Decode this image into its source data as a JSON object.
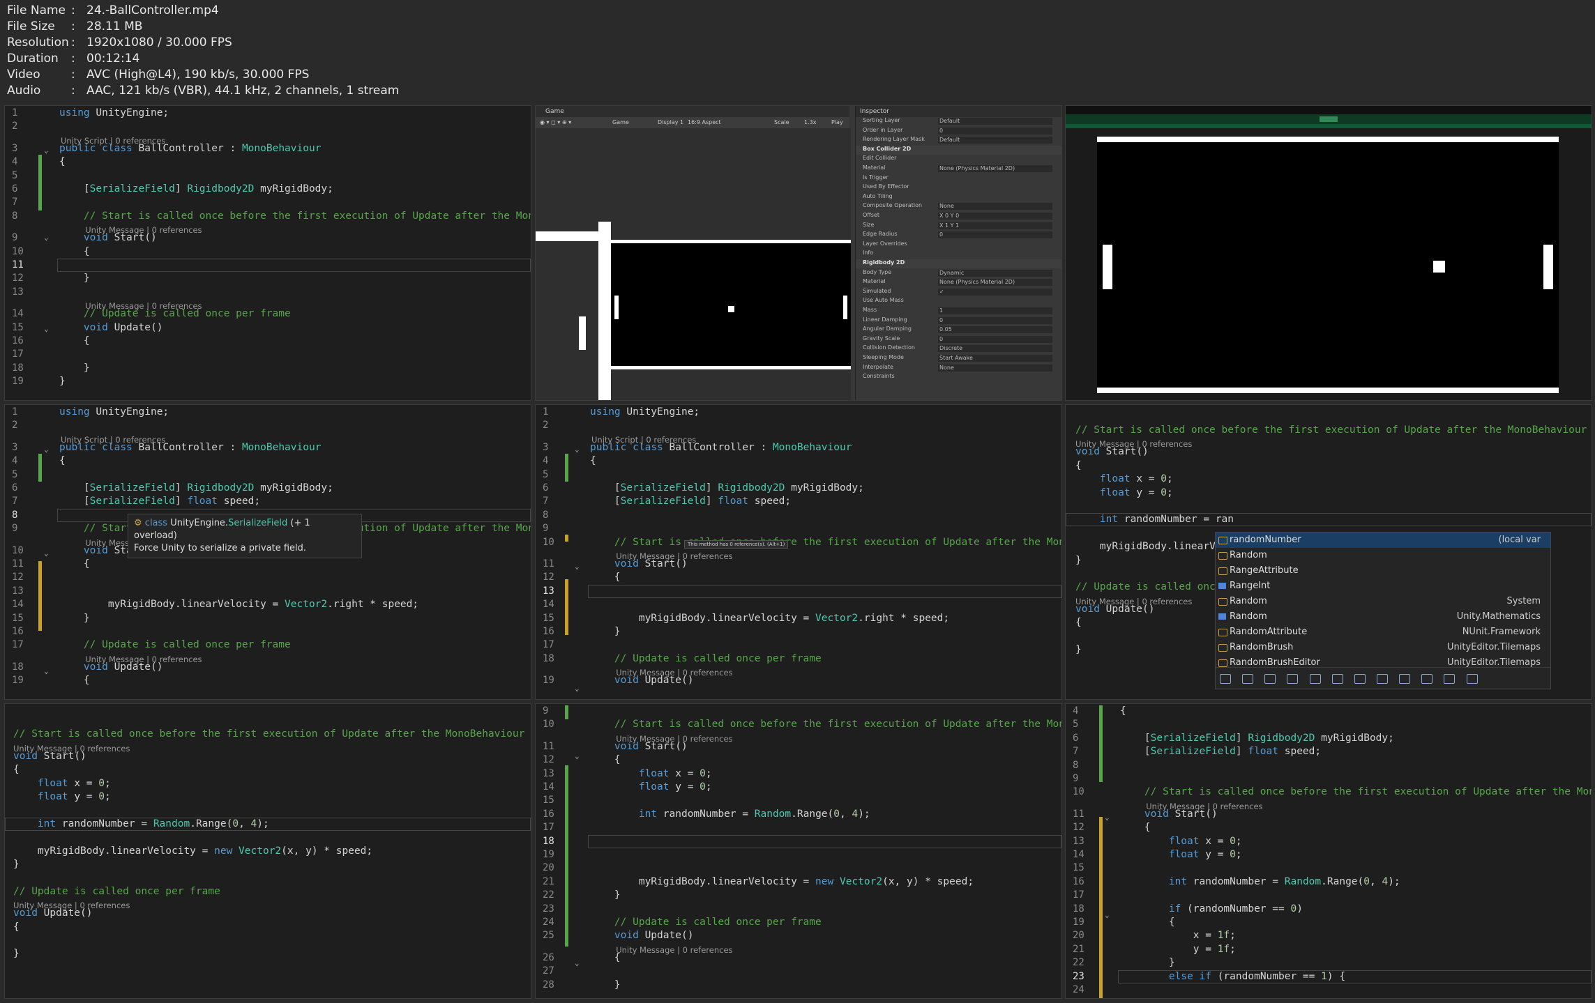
{
  "meta": {
    "rows": [
      {
        "key": "File Name",
        "value": "24.-BallController.mp4"
      },
      {
        "key": "File Size",
        "value": "28.11 MB"
      },
      {
        "key": "Resolution",
        "value": "1920x1080 / 30.000 FPS"
      },
      {
        "key": "Duration",
        "value": "00:12:14"
      },
      {
        "key": "Video",
        "value": "AVC (High@L4), 190 kb/s, 30.000 FPS"
      },
      {
        "key": "Audio",
        "value": "AAC, 121 kb/s (VBR), 44.1 kHz, 2 channels, 1 stream"
      }
    ],
    "sep": ":"
  },
  "lens": {
    "script": "Unity Script | 0 references",
    "message": "Unity Message | 0 references"
  },
  "tile1": {
    "lines": [
      {
        "n": "1",
        "t": "using UnityEngine;"
      },
      {
        "n": "2",
        "t": ""
      },
      {
        "n": "3",
        "t": "public class BallController : MonoBehaviour"
      },
      {
        "n": "4",
        "t": "{"
      },
      {
        "n": "5",
        "t": ""
      },
      {
        "n": "6",
        "t": "    [SerializeField] Rigidbody2D myRigidBody;"
      },
      {
        "n": "7",
        "t": ""
      },
      {
        "n": "8",
        "t": "    // Start is called once before the first execution of Update after the MonoBehaviour"
      },
      {
        "n": "9",
        "t": "    void Start()"
      },
      {
        "n": "10",
        "t": "    {"
      },
      {
        "n": "11",
        "t": "        "
      },
      {
        "n": "12",
        "t": "    }"
      },
      {
        "n": "13",
        "t": ""
      },
      {
        "n": "14",
        "t": "    // Update is called once per frame"
      },
      {
        "n": "15",
        "t": "    void Update()"
      },
      {
        "n": "16",
        "t": "    {"
      },
      {
        "n": "17",
        "t": ""
      },
      {
        "n": "18",
        "t": "    }"
      },
      {
        "n": "19",
        "t": "}"
      }
    ]
  },
  "tile2": {
    "tab": "Game",
    "display": "Display 1",
    "aspect": "16:9 Aspect",
    "scale_label": "Scale",
    "scale_value": "1.3x",
    "play": "Play Fo",
    "inspector_title": "Inspector",
    "rows": [
      {
        "l": "Sorting Layer",
        "v": "Default"
      },
      {
        "l": "Order in Layer",
        "v": "0"
      },
      {
        "l": "Rendering Layer Mask",
        "v": "Default"
      },
      {
        "l": "Box Collider 2D",
        "v": "",
        "h": true
      },
      {
        "l": "Edit Collider",
        "v": ""
      },
      {
        "l": "Material",
        "v": "None (Physics Material 2D)"
      },
      {
        "l": "Is Trigger",
        "v": ""
      },
      {
        "l": "Used By Effector",
        "v": ""
      },
      {
        "l": "Auto Tiling",
        "v": ""
      },
      {
        "l": "Composite Operation",
        "v": "None"
      },
      {
        "l": "Offset",
        "v": "X 0        Y 0"
      },
      {
        "l": "Size",
        "v": "X 1        Y 1"
      },
      {
        "l": "Edge Radius",
        "v": "0"
      },
      {
        "l": "Layer Overrides",
        "v": ""
      },
      {
        "l": "Info",
        "v": ""
      },
      {
        "l": "Rigidbody 2D",
        "v": "",
        "h": true
      },
      {
        "l": "Body Type",
        "v": "Dynamic"
      },
      {
        "l": "Material",
        "v": "None (Physics Material 2D)"
      },
      {
        "l": "Simulated",
        "v": "✓"
      },
      {
        "l": "Use Auto Mass",
        "v": ""
      },
      {
        "l": "Mass",
        "v": "1"
      },
      {
        "l": "Linear Damping",
        "v": "0"
      },
      {
        "l": "Angular Damping",
        "v": "0.05"
      },
      {
        "l": "Gravity Scale",
        "v": "0"
      },
      {
        "l": "Collision Detection",
        "v": "Discrete"
      },
      {
        "l": "Sleeping Mode",
        "v": "Start Awake"
      },
      {
        "l": "Interpolate",
        "v": "None"
      },
      {
        "l": "Constraints",
        "v": ""
      }
    ]
  },
  "tile4": {
    "lines": [
      {
        "n": "1",
        "t": "using UnityEngine;"
      },
      {
        "n": "2",
        "t": ""
      },
      {
        "n": "3",
        "t": "public class BallController : MonoBehaviour"
      },
      {
        "n": "4",
        "t": "{"
      },
      {
        "n": "5",
        "t": ""
      },
      {
        "n": "6",
        "t": "    [SerializeField] Rigidbody2D myRigidBody;"
      },
      {
        "n": "7",
        "t": "    [SerializeField] float speed;"
      },
      {
        "n": "8",
        "t": ""
      },
      {
        "n": "9",
        "t": "    // Start is called once before the first execution of Update after the MonoBehaviour"
      },
      {
        "n": "10",
        "t": "    void Start()"
      },
      {
        "n": "11",
        "t": "    {"
      },
      {
        "n": "12",
        "t": ""
      },
      {
        "n": "13",
        "t": ""
      },
      {
        "n": "14",
        "t": "        myRigidBody.linearVelocity = Vector2.right * speed;"
      },
      {
        "n": "15",
        "t": "    }"
      },
      {
        "n": "16",
        "t": ""
      },
      {
        "n": "17",
        "t": "    // Update is called once per frame"
      },
      {
        "n": "18",
        "t": "    void Update()"
      },
      {
        "n": "19",
        "t": "    {"
      }
    ],
    "tooltip_kind": "class",
    "tooltip_ns": "UnityEngine.",
    "tooltip_name": "SerializeField",
    "tooltip_over": " (+ 1 overload)",
    "tooltip_desc": "Force Unity to serialize a private field."
  },
  "tile5": {
    "lines": [
      {
        "n": "1",
        "t": "using UnityEngine;"
      },
      {
        "n": "2",
        "t": ""
      },
      {
        "n": "3",
        "t": "public class BallController : MonoBehaviour"
      },
      {
        "n": "4",
        "t": "{"
      },
      {
        "n": "5",
        "t": ""
      },
      {
        "n": "6",
        "t": "    [SerializeField] Rigidbody2D myRigidBody;"
      },
      {
        "n": "7",
        "t": "    [SerializeField] float speed;"
      },
      {
        "n": "8",
        "t": ""
      },
      {
        "n": "9",
        "t": ""
      },
      {
        "n": "10",
        "t": "    // Start is called once before the first execution of Update after the MonoBehaviour"
      },
      {
        "n": "11",
        "t": "    void Start()"
      },
      {
        "n": "12",
        "t": "    {"
      },
      {
        "n": "13",
        "t": ""
      },
      {
        "n": "14",
        "t": ""
      },
      {
        "n": "15",
        "t": "        myRigidBody.linearVelocity = Vector2.right * speed;"
      },
      {
        "n": "16",
        "t": "    }"
      },
      {
        "n": "17",
        "t": ""
      },
      {
        "n": "18",
        "t": "    // Update is called once per frame"
      },
      {
        "n": "19",
        "t": "    void Update()"
      }
    ],
    "hint": "This method has 0 reference(s). (Alt+1)"
  },
  "tile6": {
    "lines": [
      {
        "t": "// Start is called once before the first execution of Update after the MonoBehaviour"
      },
      {
        "t": "void Start()"
      },
      {
        "t": "{"
      },
      {
        "t": "    float x = 0;"
      },
      {
        "t": "    float y = 0;"
      },
      {
        "t": ""
      },
      {
        "t": "    int randomNumber = ran"
      },
      {
        "t": ""
      },
      {
        "t": "    myRigidBody.linearV"
      },
      {
        "t": "}"
      },
      {
        "t": ""
      },
      {
        "t": "// Update is called onc"
      },
      {
        "t": "void Update()"
      },
      {
        "t": "{"
      },
      {
        "t": ""
      },
      {
        "t": "}"
      }
    ],
    "completions": [
      {
        "label": "randomNumber",
        "ns": "(local var",
        "icon": "cls"
      },
      {
        "label": "Random",
        "ns": "",
        "icon": "cls"
      },
      {
        "label": "RangeAttribute",
        "ns": "",
        "icon": "cls"
      },
      {
        "label": "RangeInt",
        "ns": "",
        "icon": "st"
      },
      {
        "label": "Random",
        "ns": "System",
        "icon": "cls"
      },
      {
        "label": "Random",
        "ns": "Unity.Mathematics",
        "icon": "st"
      },
      {
        "label": "RandomAttribute",
        "ns": "NUnit.Framework",
        "icon": "cls"
      },
      {
        "label": "RandomBrush",
        "ns": "UnityEditor.Tilemaps",
        "icon": "cls"
      },
      {
        "label": "RandomBrushEditor",
        "ns": "UnityEditor.Tilemaps",
        "icon": "cls"
      }
    ]
  },
  "tile7": {
    "lines": [
      {
        "t": ""
      },
      {
        "t": "// Start is called once before the first execution of Update after the MonoBehaviour"
      },
      {
        "t": "void Start()"
      },
      {
        "t": "{"
      },
      {
        "t": "    float x = 0;"
      },
      {
        "t": "    float y = 0;"
      },
      {
        "t": ""
      },
      {
        "t": "    int randomNumber = Random.Range(0, 4);"
      },
      {
        "t": ""
      },
      {
        "t": "    myRigidBody.linearVelocity = new Vector2(x, y) * speed;"
      },
      {
        "t": "}"
      },
      {
        "t": ""
      },
      {
        "t": "// Update is called once per frame"
      },
      {
        "t": "void Update()"
      },
      {
        "t": "{"
      },
      {
        "t": ""
      },
      {
        "t": "}"
      }
    ]
  },
  "tile8": {
    "lines": [
      {
        "n": "9",
        "t": ""
      },
      {
        "n": "10",
        "t": "    // Start is called once before the first execution of Update after the MonoBehaviour"
      },
      {
        "n": "11",
        "t": "    void Start()"
      },
      {
        "n": "12",
        "t": "    {"
      },
      {
        "n": "13",
        "t": "        float x = 0;"
      },
      {
        "n": "14",
        "t": "        float y = 0;"
      },
      {
        "n": "15",
        "t": ""
      },
      {
        "n": "16",
        "t": "        int randomNumber = Random.Range(0, 4);"
      },
      {
        "n": "17",
        "t": ""
      },
      {
        "n": "18",
        "t": ""
      },
      {
        "n": "19",
        "t": ""
      },
      {
        "n": "20",
        "t": ""
      },
      {
        "n": "21",
        "t": "        myRigidBody.linearVelocity = new Vector2(x, y) * speed;"
      },
      {
        "n": "22",
        "t": "    }"
      },
      {
        "n": "23",
        "t": ""
      },
      {
        "n": "24",
        "t": "    // Update is called once per frame"
      },
      {
        "n": "25",
        "t": "    void Update()"
      },
      {
        "n": "26",
        "t": "    {"
      },
      {
        "n": "27",
        "t": ""
      },
      {
        "n": "28",
        "t": "    }"
      }
    ]
  },
  "tile9": {
    "lines": [
      {
        "n": "4",
        "t": "{"
      },
      {
        "n": "5",
        "t": ""
      },
      {
        "n": "6",
        "t": "    [SerializeField] Rigidbody2D myRigidBody;"
      },
      {
        "n": "7",
        "t": "    [SerializeField] float speed;"
      },
      {
        "n": "8",
        "t": ""
      },
      {
        "n": "9",
        "t": ""
      },
      {
        "n": "10",
        "t": "    // Start is called once before the first execution of Update after the MonoBehaviour"
      },
      {
        "n": "11",
        "t": "    void Start()"
      },
      {
        "n": "12",
        "t": "    {"
      },
      {
        "n": "13",
        "t": "        float x = 0;"
      },
      {
        "n": "14",
        "t": "        float y = 0;"
      },
      {
        "n": "15",
        "t": ""
      },
      {
        "n": "16",
        "t": "        int randomNumber = Random.Range(0, 4);"
      },
      {
        "n": "17",
        "t": ""
      },
      {
        "n": "18",
        "t": "        if (randomNumber == 0)"
      },
      {
        "n": "19",
        "t": "        {"
      },
      {
        "n": "20",
        "t": "            x = 1f;"
      },
      {
        "n": "21",
        "t": "            y = 1f;"
      },
      {
        "n": "22",
        "t": "        }"
      },
      {
        "n": "23",
        "t": "        else if (randomNumber == 1) {"
      },
      {
        "n": "24",
        "t": ""
      }
    ]
  }
}
